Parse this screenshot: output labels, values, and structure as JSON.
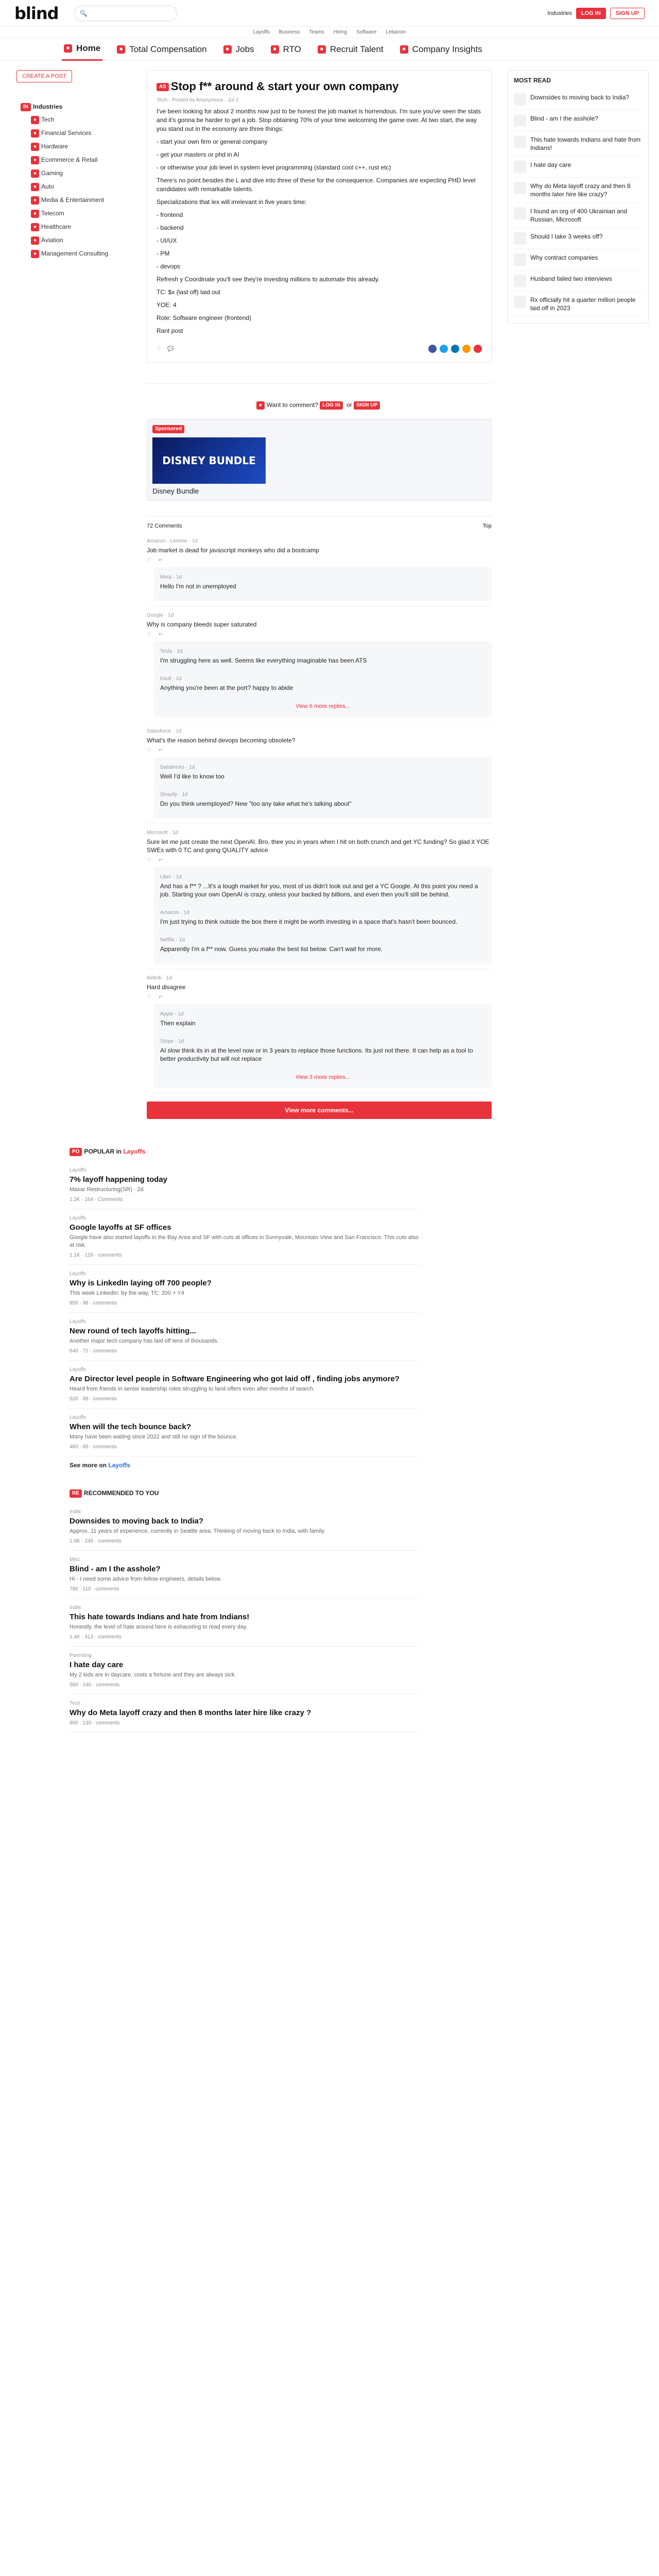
{
  "header": {
    "logo": "blind",
    "search_placeholder": "",
    "region": "Industries",
    "login": "LOG IN",
    "signup": "SIGN UP"
  },
  "subnav": [
    "Layoffs",
    "Business",
    "Teams",
    "Hiring",
    "Software",
    "Lebanon"
  ],
  "nav": [
    {
      "label": "Home",
      "active": true
    },
    {
      "label": "Total Compensation"
    },
    {
      "label": "Jobs"
    },
    {
      "label": "RTO"
    },
    {
      "label": "Recruit Talent"
    },
    {
      "label": "Company Insights"
    }
  ],
  "sidebar": {
    "create_post": "CREATE A POST",
    "industry_head": "Industries",
    "industries": [
      "Tech",
      "Financial Services",
      "Hardware",
      "Ecommerce & Retail",
      "Gaming",
      "Auto",
      "Media & Entertainment",
      "Telecom",
      "Healthcare",
      "Aviation",
      "Management Consulting"
    ]
  },
  "post": {
    "tag": "AS",
    "title": "Stop f** around & start your own company",
    "meta1": "Tech · Posted by Anonymous · Jul 2",
    "views": "",
    "paragraphs": [
      "I've been looking for about 2 months now just to be honest the job market is horrendous. I'm sure you've seen the stats and it's gonna be harder to get a job. Stop obtaining 70% of your time welcoming the game over. At two start, the way you stand out in the economy are three things:",
      "- start your own firm or general company",
      "- get your masters or phd in AI",
      "- or otherwise your job level in system level programming (standard cool c++, rust etc)",
      "There's no point besides the L and dive into three of these for the consequence. Companies are expecting PHD level candidates with remarkable talents.",
      "Specializations that lex will irrelevant in five years time:",
      "- frontend",
      "- backend",
      "- UI/UX",
      "- PM",
      "- devops",
      "Refresh y Coordinate you'll see they're investing millions to automate this already.",
      "TC: $x (last off) laid out",
      "YOE: 4",
      "Role: Software engineer (frontend)",
      "Rant post"
    ],
    "footer_views": "",
    "footer_comments": ""
  },
  "signin": {
    "text": "Want to comment?",
    "login": "LOG IN",
    "or": "or",
    "signup": "SIGN UP"
  },
  "ad": {
    "sponsor": "Sponsored",
    "label": "Disney Bundle",
    "image_text": "DISNEY BUNDLE"
  },
  "comments_section": {
    "count": "72 Comments",
    "sort": "Top",
    "view_all": "View more comments..."
  },
  "comments": [
    {
      "meta": "Amazon · Lemme · 1d",
      "text": "Job market is dead for javascript monkeys who did a bootcamp",
      "replies": [
        {
          "meta": "Meta · 1d",
          "text": "Hello I'm not in unemployed"
        }
      ]
    },
    {
      "meta": "Google · 1d",
      "text": "Why is company bleeds super saturated",
      "replies": [
        {
          "meta": "Tesla · 1d",
          "text": "I'm struggling here as well. Seems like everything imaginable has been ATS"
        },
        {
          "meta": "Intuit · 1d",
          "text": "Anything you're been at the port? happy to abide"
        }
      ],
      "more": "View 6 more replies..."
    },
    {
      "meta": "Salesforce · 1d",
      "text": "What's the reason behind devops becoming obsolete?",
      "replies": [
        {
          "meta": "Databricks · 1d",
          "text": "Well I'd like to know too"
        },
        {
          "meta": "Shopify · 1d",
          "text": "Do you think unemployed? New \"too any take what he's talking about\""
        }
      ]
    },
    {
      "meta": "Microsoft · 1d",
      "text": "Sure let me just create the next OpenAI. Bro, thee you in years when I hit on both crunch and get YC funding? So glad it YOE SWEs with 0 TC and going QUALITY advice",
      "replies": [
        {
          "meta": "Uber · 1d",
          "text": "And has a f** ? ...It's a tough market for you, most of us didn't look out and get a YC Google. At this point you need a job. Starting your own OpenAI is crazy, unless your backed by billions, and even then you'll still be behind."
        },
        {
          "meta": "Amazon · 1d",
          "text": "I'm just trying to think outside the box there it might be worth investing in a space that's hasn't been bounced."
        },
        {
          "meta": "Netflix · 1d",
          "text": "Apparently I'm a f** now. Guess you make the best list below. Can't wait for more."
        }
      ]
    },
    {
      "meta": "Airbnb · 1d",
      "text": "Hard disagree",
      "replies": [
        {
          "meta": "Apple · 1d",
          "text": "Then explain"
        },
        {
          "meta": "Stripe · 1d",
          "text": "AI slow think its in at the level now or in 3 years to replace those functions. Its just not there. It can help as a tool to better productivity but will not replace"
        }
      ],
      "more": "View 3 more replies..."
    }
  ],
  "most_read": {
    "title": "MOST READ",
    "items": [
      "Downsides to moving back to India?",
      "Blind - am I the asshole?",
      "This hate towards Indians and hate from Indians!",
      "I hate day care",
      "Why do Meta layoff crazy and then 8 months later hire like crazy?",
      "I found an org of 400 Ukrainian and Russian, Microsoft",
      "Should I take 3 weeks off?",
      "Why contract companies",
      "Husband failed two interviews",
      "Rx officially hit a quarter million people laid off in 2023"
    ]
  },
  "popular": {
    "heading_tag": "PO",
    "heading": "POPULAR in",
    "heading_link": "Layoffs",
    "items": [
      {
        "cat": "Layoffs",
        "title": "7% layoff happening today",
        "preview": "Maxar Restructuring(SR) · 2d",
        "stats": "1.2K · 164 · Comments"
      },
      {
        "cat": "Layoffs",
        "title": "Google layoffs at SF offices",
        "preview": "Google have also started layoffs in the Bay Area and SF with cuts at offices in Sunnyvale, Mountain View and San Francisco. This cuts also at risk.",
        "stats": "1.1K · 126 · comments"
      },
      {
        "cat": "Layoffs",
        "title": "Why is LinkedIn laying off 700 people?",
        "preview": "This week LinkedIn: by the way, TC: 200 + Y4",
        "stats": "850 · 98 · comments"
      },
      {
        "cat": "Layoffs",
        "title": "New round of tech layoffs hitting...",
        "preview": "Another major tech company has laid off tens of thousands.",
        "stats": "640 · 71 · comments"
      },
      {
        "cat": "Layoffs",
        "title": "Are Director level people in Software Engineering who got laid off , finding jobs anymore?",
        "preview": "Heard from friends in senior leadership roles struggling to land offers even after months of search.",
        "stats": "520 · 88 · comments"
      },
      {
        "cat": "Layoffs",
        "title": "When will the tech bounce back?",
        "preview": "Many have been waiting since 2022 and still no sign of the bounce.",
        "stats": "480 · 65 · comments"
      }
    ],
    "see_more": "See more on",
    "see_more_link": "Layoffs"
  },
  "recommended": {
    "heading_tag": "RE",
    "heading": "RECOMMENDED TO YOU",
    "items": [
      {
        "cat": "India",
        "title": "Downsides to moving back to India?",
        "preview": "Approx. 11 years of experience, currently in Seattle area. Thinking of moving back to India, with family.",
        "stats": "1.0K · 245 · comments"
      },
      {
        "cat": "Misc",
        "title": "Blind - am I the asshole?",
        "preview": "Hi - I need some advice from fellow engineers, details below.",
        "stats": "790 · 110 · comments"
      },
      {
        "cat": "India",
        "title": "This hate towards Indians and hate from Indians!",
        "preview": "Honestly, the level of hate around here is exhausting to read every day.",
        "stats": "1.4K · 412 · comments"
      },
      {
        "cat": "Parenting",
        "title": "I hate day care",
        "preview": "My 2 kids are in daycare, costs a fortune and they are always sick.",
        "stats": "560 · 140 · comments"
      },
      {
        "cat": "Tech",
        "title": "Why do Meta layoff crazy and then 8 months later hire like crazy ?",
        "preview": "",
        "stats": "900 · 130 · comments"
      }
    ]
  }
}
